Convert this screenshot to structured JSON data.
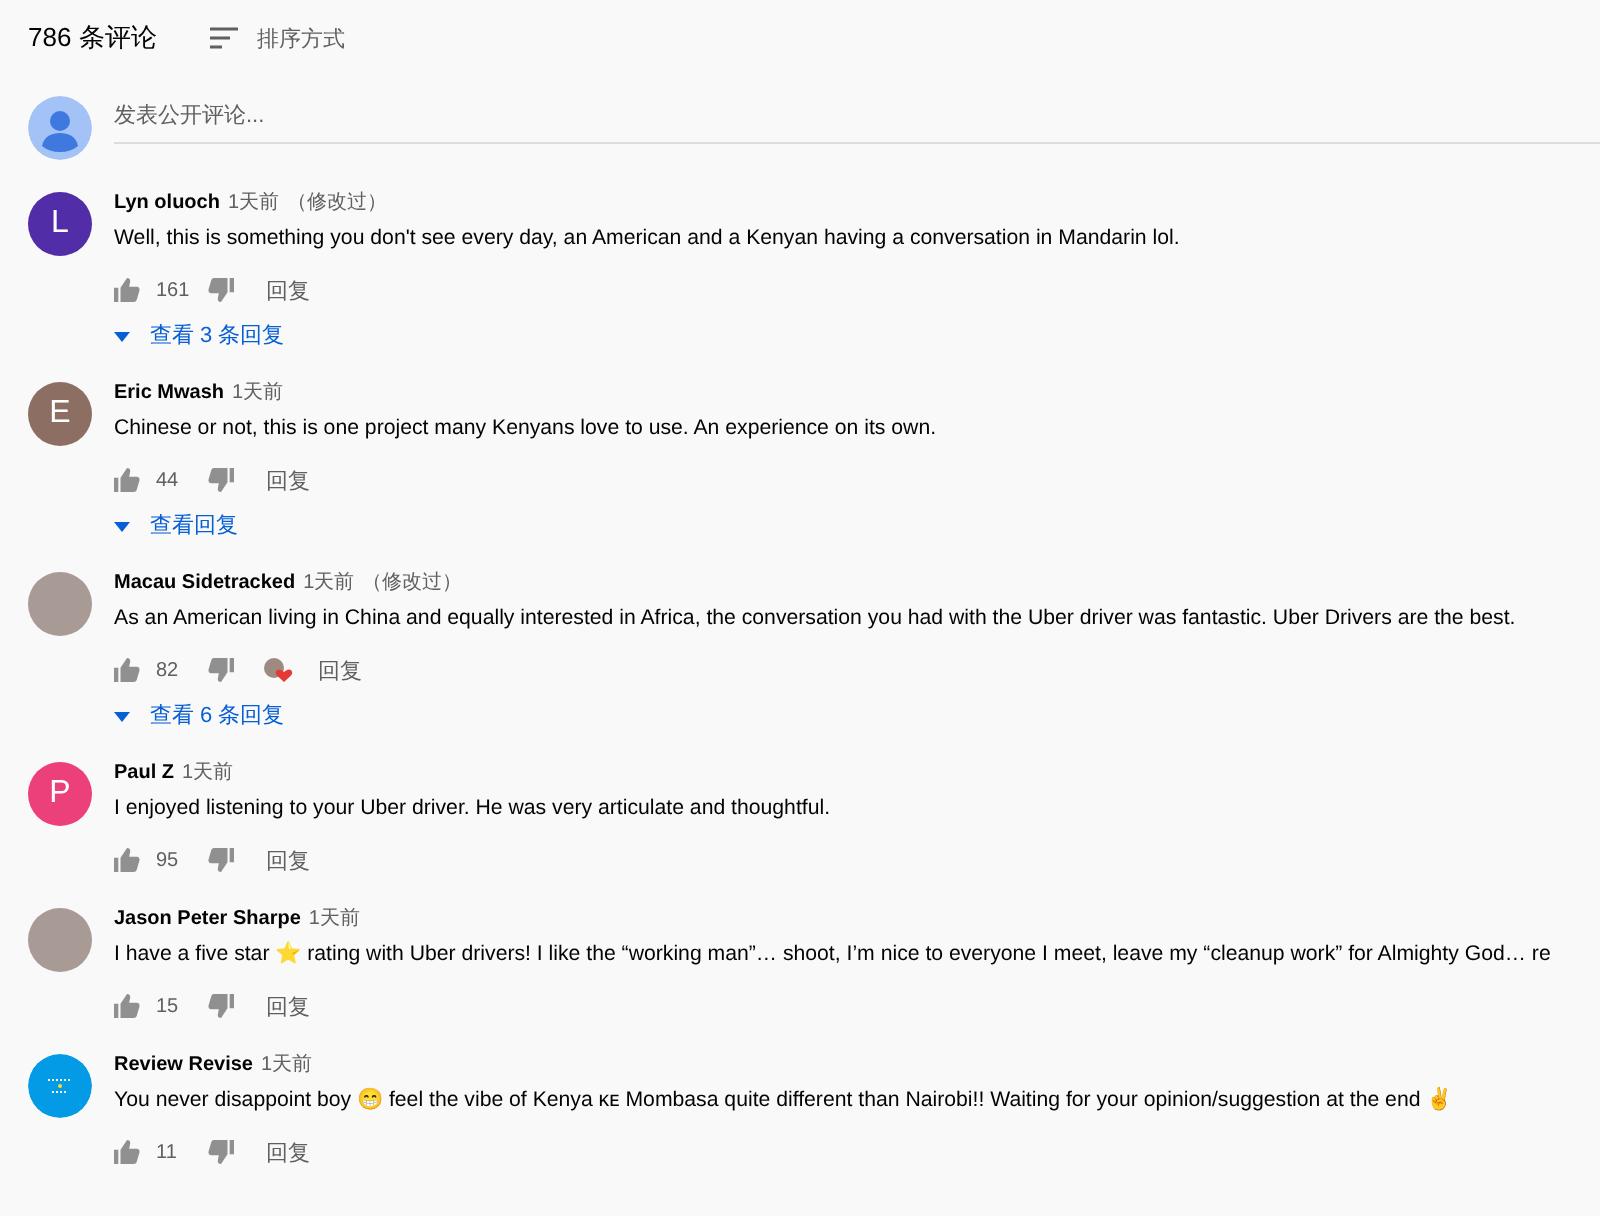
{
  "header": {
    "count": "786 条评论",
    "sort_label": "排序方式"
  },
  "composer": {
    "placeholder": "发表公开评论..."
  },
  "comments": [
    {
      "avatar": {
        "kind": "letter",
        "letter": "L",
        "color": "#512da8"
      },
      "author": "Lyn oluoch",
      "time": "1天前",
      "edited": "（修改过）",
      "text": "Well, this is something you don't see every day, an American and a Kenyan having a conversation in Mandarin lol.",
      "likes": "161",
      "hearted": false,
      "reply": "回复",
      "replies": "查看 3 条回复"
    },
    {
      "avatar": {
        "kind": "letter",
        "letter": "E",
        "color": "#8d6e63"
      },
      "author": "Eric Mwash",
      "time": "1天前",
      "text": "Chinese or not, this is one project many Kenyans love to use. An experience on its own.",
      "likes": "44",
      "hearted": false,
      "reply": "回复",
      "replies": "查看回复"
    },
    {
      "avatar": {
        "kind": "photo"
      },
      "author": "Macau Sidetracked",
      "time": "1天前",
      "edited": "（修改过）",
      "text": "As an American living in China and equally interested in Africa, the conversation you had with the Uber driver was fantastic.  Uber Drivers are the best.",
      "likes": "82",
      "hearted": true,
      "reply": "回复",
      "replies": "查看 6 条回复"
    },
    {
      "avatar": {
        "kind": "letter",
        "letter": "P",
        "color": "#ec407a"
      },
      "author": "Paul Z",
      "time": "1天前",
      "text": "I enjoyed listening to your Uber driver. He was very articulate and thoughtful.",
      "likes": "95",
      "hearted": false,
      "reply": "回复"
    },
    {
      "avatar": {
        "kind": "photo"
      },
      "author": "Jason Peter Sharpe",
      "time": "1天前",
      "text": "I have a five star ⭐ rating with Uber drivers! I like the “working man”… shoot, I’m nice to everyone I meet, leave my “cleanup work” for Almighty God… re",
      "likes": "15",
      "hearted": false,
      "reply": "回复"
    },
    {
      "avatar": {
        "kind": "logo",
        "color": "#039be5"
      },
      "author": "Review Revise",
      "time": "1天前",
      "text": "You never disappoint boy 😁 feel the vibe of Kenya ᴋᴇ Mombasa quite different than Nairobi!! Waiting for your opinion/suggestion at the end ✌",
      "likes": "11",
      "hearted": false,
      "reply": "回复"
    }
  ]
}
